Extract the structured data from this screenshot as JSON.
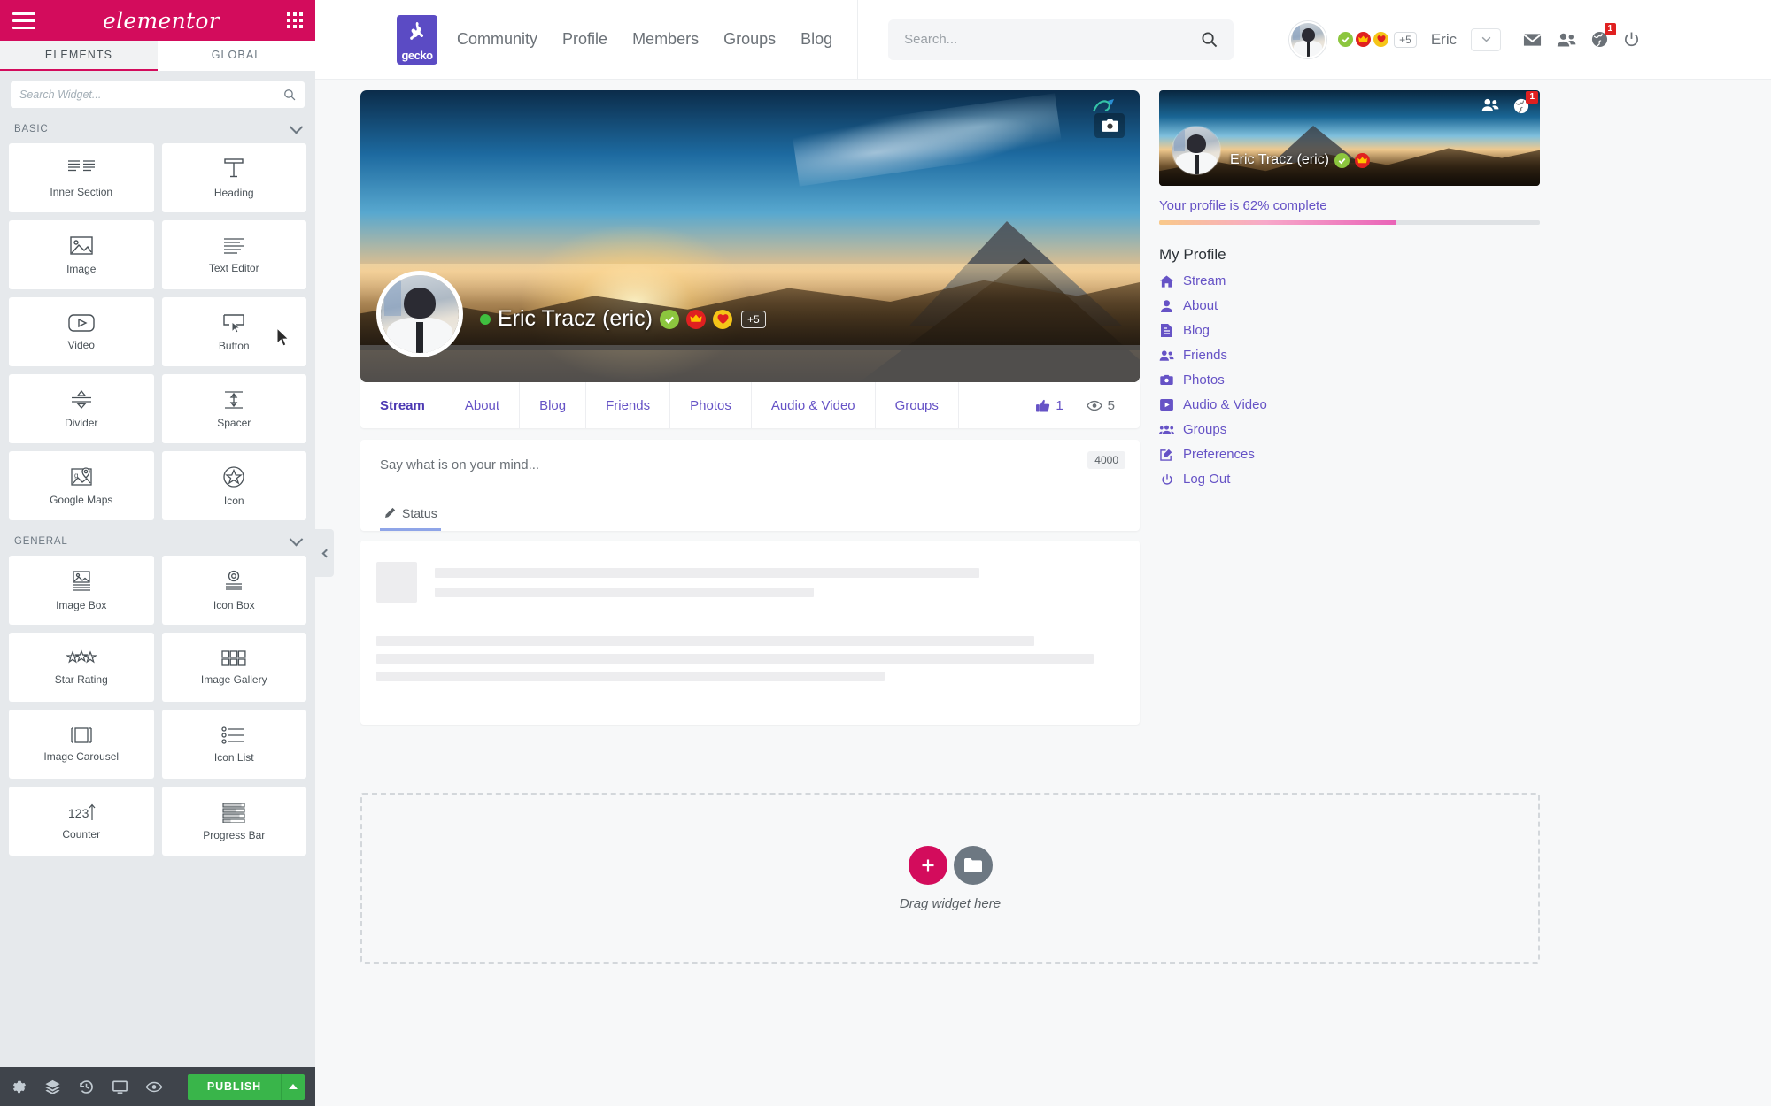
{
  "editor": {
    "brand": "elementor",
    "menu_icon": "hamburger-icon",
    "apps_icon": "grid-apps-icon",
    "tabs": [
      {
        "label": "ELEMENTS",
        "active": true
      },
      {
        "label": "GLOBAL",
        "active": false
      }
    ],
    "search_placeholder": "Search Widget...",
    "search_value": "",
    "categories": [
      {
        "name": "BASIC",
        "widgets": [
          {
            "label": "Inner Section",
            "icon": "inner-section-icon"
          },
          {
            "label": "Heading",
            "icon": "heading-icon"
          },
          {
            "label": "Image",
            "icon": "image-icon"
          },
          {
            "label": "Text Editor",
            "icon": "text-editor-icon"
          },
          {
            "label": "Video",
            "icon": "video-icon"
          },
          {
            "label": "Button",
            "icon": "button-icon"
          },
          {
            "label": "Divider",
            "icon": "divider-icon"
          },
          {
            "label": "Spacer",
            "icon": "spacer-icon"
          },
          {
            "label": "Google Maps",
            "icon": "google-maps-icon"
          },
          {
            "label": "Icon",
            "icon": "star-circle-icon"
          }
        ]
      },
      {
        "name": "GENERAL",
        "widgets": [
          {
            "label": "Image Box",
            "icon": "image-box-icon"
          },
          {
            "label": "Icon Box",
            "icon": "icon-box-icon"
          },
          {
            "label": "Star Rating",
            "icon": "star-rating-icon"
          },
          {
            "label": "Image Gallery",
            "icon": "image-gallery-icon"
          },
          {
            "label": "Image Carousel",
            "icon": "image-carousel-icon"
          },
          {
            "label": "Icon List",
            "icon": "icon-list-icon"
          },
          {
            "label": "Counter",
            "icon": "counter-icon"
          },
          {
            "label": "Progress Bar",
            "icon": "progress-bar-icon"
          }
        ]
      }
    ],
    "footer": {
      "icons": [
        "settings-gear-icon",
        "navigator-layers-icon",
        "history-revisions-icon",
        "responsive-mode-icon",
        "preview-eye-icon"
      ],
      "publish_label": "PUBLISH",
      "publish_caret": "caret-up-icon",
      "publish_color": "#39b54a"
    },
    "collapse_handle": "panel-collapse-icon",
    "accent_color": "#d30c5c"
  },
  "site": {
    "logo_text": "gecko",
    "nav": [
      "Community",
      "Profile",
      "Members",
      "Groups",
      "Blog"
    ],
    "search_placeholder": "Search...",
    "search_value": "",
    "user": {
      "name": "Eric",
      "badges": [
        "verified-check-badge",
        "crown-badge",
        "heart-badge"
      ],
      "badge_overflow": "+5",
      "caret": "chevron-down-icon"
    },
    "header_icons": [
      {
        "name": "messages-envelope-icon",
        "badge": ""
      },
      {
        "name": "friends-icon",
        "badge": ""
      },
      {
        "name": "notifications-globe-icon",
        "badge": "1"
      },
      {
        "name": "logout-power-icon",
        "badge": ""
      }
    ]
  },
  "profile": {
    "display_name": "Eric Tracz (eric)",
    "online_status": "online",
    "badges": [
      "verified-check-badge",
      "crown-badge",
      "heart-badge"
    ],
    "badge_overflow": "+5",
    "cover_camera": "camera-icon",
    "tabs": [
      {
        "label": "Stream",
        "active": true
      },
      {
        "label": "About",
        "active": false
      },
      {
        "label": "Blog",
        "active": false
      },
      {
        "label": "Friends",
        "active": false
      },
      {
        "label": "Photos",
        "active": false
      },
      {
        "label": "Audio & Video",
        "active": false
      },
      {
        "label": "Groups",
        "active": false
      }
    ],
    "stats": {
      "likes_icon": "thumbs-up-icon",
      "likes": "1",
      "views_icon": "eye-icon",
      "views": "5"
    },
    "composer": {
      "placeholder": "Say what is on your mind...",
      "char_limit": "4000",
      "tab_label": "Status",
      "tab_icon": "pencil-icon"
    }
  },
  "sidebar": {
    "mini_profile": {
      "display_name": "Eric Tracz (eric)",
      "badges": [
        "verified-check-badge",
        "crown-badge"
      ],
      "icons": [
        {
          "name": "friends-icon",
          "badge": ""
        },
        {
          "name": "notifications-globe-icon",
          "badge": "1"
        }
      ]
    },
    "progress": {
      "label": "Your profile is 62% complete",
      "percent": 62,
      "gradient_from": "#f9c98a",
      "gradient_to": "#e964b8"
    },
    "menu_title": "My Profile",
    "menu_items": [
      {
        "label": "Stream",
        "icon": "home-icon"
      },
      {
        "label": "About",
        "icon": "user-icon"
      },
      {
        "label": "Blog",
        "icon": "file-icon"
      },
      {
        "label": "Friends",
        "icon": "friends-icon"
      },
      {
        "label": "Photos",
        "icon": "camera-icon"
      },
      {
        "label": "Audio & Video",
        "icon": "play-box-icon"
      },
      {
        "label": "Groups",
        "icon": "group-icon"
      },
      {
        "label": "Preferences",
        "icon": "edit-square-icon"
      },
      {
        "label": "Log Out",
        "icon": "power-icon"
      }
    ],
    "link_color": "#6653c6"
  },
  "dropzone": {
    "add_icon": "plus-icon",
    "folder_icon": "folder-icon",
    "text": "Drag widget here"
  }
}
